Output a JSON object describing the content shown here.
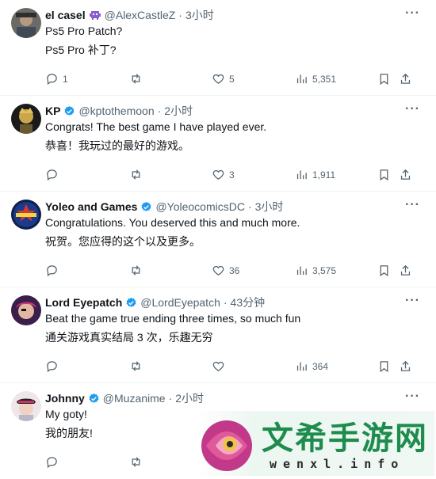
{
  "replies": [
    {
      "name": "el casel",
      "handle": "@AlexCastleZ",
      "time": "3小时",
      "lines": [
        "Ps5 Pro Patch?",
        "Ps5 Pro 补丁?"
      ],
      "verified": false,
      "badge_icon": "alien-icon",
      "replies_count": "1",
      "likes": "5",
      "views": "5,351"
    },
    {
      "name": "KP",
      "handle": "@kptothemoon",
      "time": "2小时",
      "lines": [
        "Congrats! The best game I have played ever.",
        "恭喜！我玩过的最好的游戏。"
      ],
      "verified": true,
      "replies_count": "",
      "likes": "3",
      "views": "1,911"
    },
    {
      "name": "Yoleo and Games",
      "handle": "@YoleocomicsDC",
      "time": "3小时",
      "lines": [
        "Congratulations. You deserved this and much more.",
        "祝贺。您应得的这个以及更多。"
      ],
      "verified": true,
      "replies_count": "",
      "likes": "36",
      "views": "3,575"
    },
    {
      "name": "Lord Eyepatch",
      "handle": "@LordEyepatch",
      "time": "43分钟",
      "lines": [
        "Beat the game true ending three times, so much fun",
        "通关游戏真实结局 3 次，乐趣无穷"
      ],
      "verified": true,
      "replies_count": "",
      "likes": "",
      "views": "364"
    },
    {
      "name": "Johnny",
      "handle": "@Muzanime",
      "time": "2小时",
      "lines": [
        "My goty!",
        "我的朋友!"
      ],
      "verified": true,
      "replies_count": "",
      "likes": "",
      "views": ""
    }
  ],
  "separator": "·",
  "more_label": "···",
  "watermark": {
    "title": "文希手游网",
    "subtitle": "wenxl.info"
  },
  "colors": {
    "verified_blue": "#1d9bf0",
    "secondary_text": "#536471",
    "watermark_green": "#1d8c4c"
  }
}
